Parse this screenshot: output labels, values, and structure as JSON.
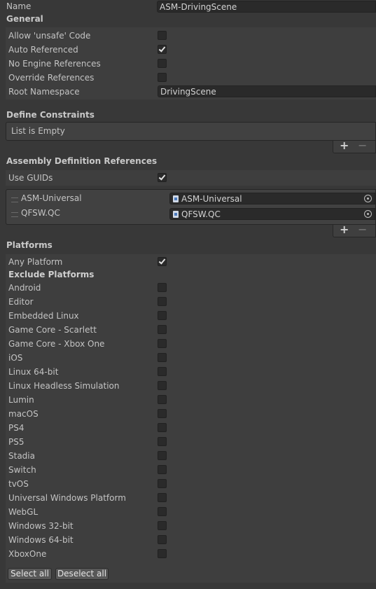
{
  "name_row": {
    "label": "Name",
    "value": "ASM-DrivingScene"
  },
  "general": {
    "header": "General",
    "rows": [
      {
        "label": "Allow 'unsafe' Code",
        "checked": false
      },
      {
        "label": "Auto Referenced",
        "checked": true
      },
      {
        "label": "No Engine References",
        "checked": false
      },
      {
        "label": "Override References",
        "checked": false
      }
    ],
    "root_namespace_label": "Root Namespace",
    "root_namespace_value": "DrivingScene"
  },
  "define_constraints": {
    "header": "Define Constraints",
    "empty_text": "List is Empty",
    "add_icon": "plus-icon",
    "remove_icon": "minus-icon"
  },
  "assembly_refs": {
    "header": "Assembly Definition References",
    "use_guids_label": "Use GUIDs",
    "use_guids_checked": true,
    "items": [
      {
        "label": "ASM-Universal",
        "value": "ASM-Universal"
      },
      {
        "label": "QFSW.QC",
        "value": "QFSW.QC"
      }
    ],
    "add_icon": "plus-icon",
    "remove_icon": "minus-icon"
  },
  "platforms": {
    "header": "Platforms",
    "any_platform_label": "Any Platform",
    "any_platform_checked": true,
    "exclude_header": "Exclude Platforms",
    "items": [
      {
        "label": "Android",
        "checked": false
      },
      {
        "label": "Editor",
        "checked": false
      },
      {
        "label": "Embedded Linux",
        "checked": false
      },
      {
        "label": "Game Core - Scarlett",
        "checked": false
      },
      {
        "label": "Game Core - Xbox One",
        "checked": false
      },
      {
        "label": "iOS",
        "checked": false
      },
      {
        "label": "Linux 64-bit",
        "checked": false
      },
      {
        "label": "Linux Headless Simulation",
        "checked": false
      },
      {
        "label": "Lumin",
        "checked": false
      },
      {
        "label": "macOS",
        "checked": false
      },
      {
        "label": "PS4",
        "checked": false
      },
      {
        "label": "PS5",
        "checked": false
      },
      {
        "label": "Stadia",
        "checked": false
      },
      {
        "label": "Switch",
        "checked": false
      },
      {
        "label": "tvOS",
        "checked": false
      },
      {
        "label": "Universal Windows Platform",
        "checked": false
      },
      {
        "label": "WebGL",
        "checked": false
      },
      {
        "label": "Windows 32-bit",
        "checked": false
      },
      {
        "label": "Windows 64-bit",
        "checked": false
      },
      {
        "label": "XboxOne",
        "checked": false
      }
    ],
    "select_all_label": "Select all",
    "deselect_all_label": "Deselect all"
  }
}
